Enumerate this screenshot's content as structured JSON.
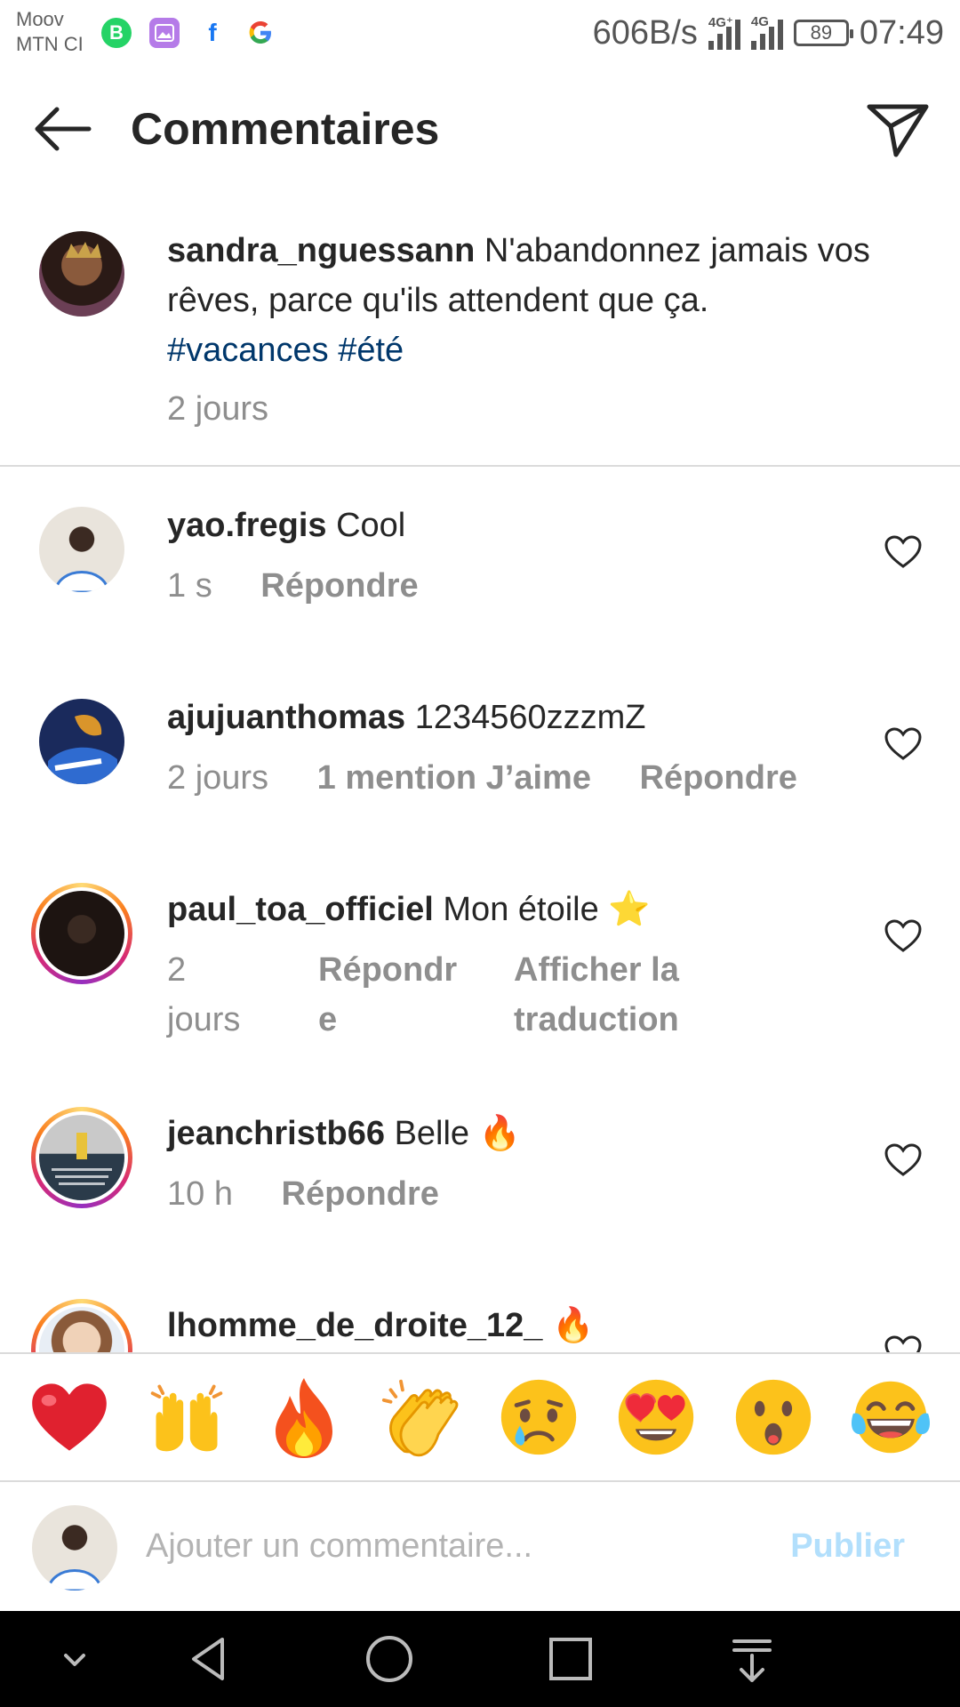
{
  "status_bar": {
    "carrier_line1": "Moov",
    "carrier_line2": "MTN CI",
    "speed": "606B/s",
    "signal1_tag": "4G⁺",
    "signal2_tag": "4G",
    "battery": "89",
    "time": "07:49",
    "app_icons": [
      "whatsapp-business-icon",
      "gallery-icon",
      "facebook-icon",
      "google-icon"
    ]
  },
  "header": {
    "title": "Commentaires",
    "back_icon": "arrow-left-icon",
    "share_icon": "send-icon"
  },
  "caption": {
    "username": "sandra_nguessann",
    "text": "N'abandonnez jamais vos rêves, parce qu'ils attendent que ça.",
    "hashtags": "#vacances #été",
    "time": "2 jours"
  },
  "comments": [
    {
      "username": "yao.fregis",
      "text": "Cool",
      "time": "1 s",
      "reply": "Répondre"
    },
    {
      "username": "ajujuanthomas",
      "text": "1234560zzzmZ",
      "time": "2 jours",
      "likes": "1 mention J’aime",
      "reply": "Répondre"
    },
    {
      "username": "paul_toa_officiel",
      "text": "Mon étoile ⭐",
      "time_line1": "2",
      "time_line2": "jours",
      "reply_line1": "Répondr",
      "reply_line2": "e",
      "translate_line1": "Afficher la",
      "translate_line2": "traduction"
    },
    {
      "username": "jeanchristb66",
      "text": "Belle 🔥",
      "time": "10 h",
      "reply": "Répondre"
    },
    {
      "username": "lhomme_de_droite_12_",
      "text": "🔥"
    }
  ],
  "emoji_bar": [
    "❤️",
    "🙌",
    "🔥",
    "👏",
    "😢",
    "😍",
    "😮",
    "😂"
  ],
  "composer": {
    "placeholder": "Ajouter un commentaire...",
    "publish": "Publier"
  },
  "colors": {
    "text": "#262626",
    "meta": "#8e8e8e",
    "hashtag": "#00376b",
    "publish_disabled": "#b2dffc",
    "divider": "#dbdbdb"
  }
}
